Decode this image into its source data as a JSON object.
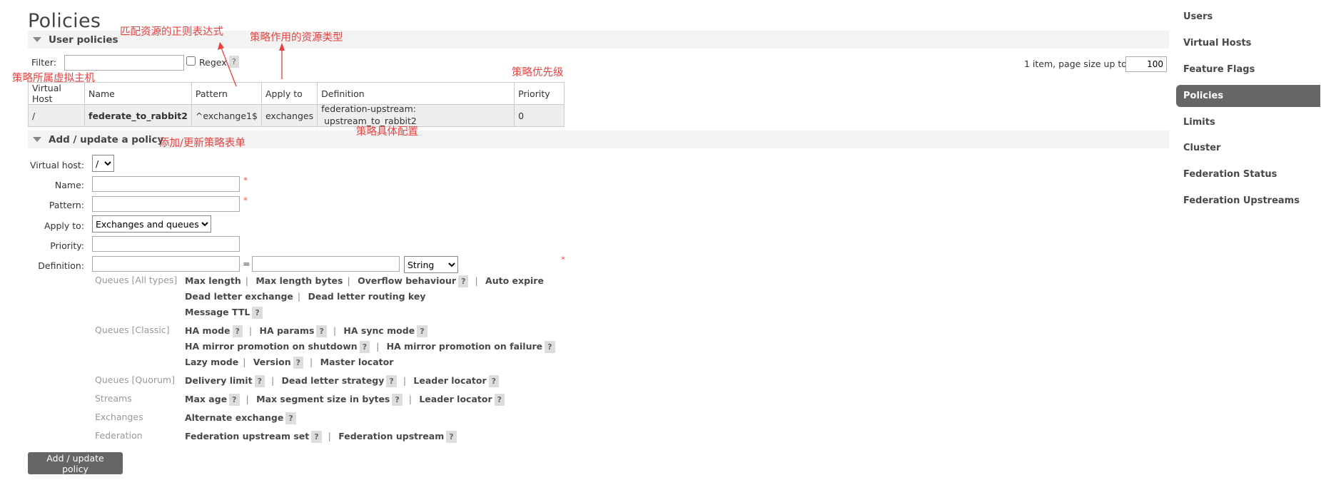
{
  "page": {
    "title": "Policies"
  },
  "user_policies": {
    "header": "User policies",
    "filter_label": "Filter:",
    "filter_value": "",
    "regex_label": "Regex",
    "help": "?",
    "pagination_text": "1 item, page size up to",
    "page_size": "100",
    "table": {
      "columns": [
        "Virtual Host",
        "Name",
        "Pattern",
        "Apply to",
        "Definition",
        "Priority"
      ],
      "rows": [
        {
          "vhost": "/",
          "name": "federate_to_rabbit2",
          "pattern": "^exchange1$",
          "apply_to": "exchanges",
          "definition_key": "federation-upstream:",
          "definition_value": "upstream_to_rabbit2",
          "priority": "0"
        }
      ]
    }
  },
  "add_policy": {
    "header": "Add / update a policy",
    "virtual_host_label": "Virtual host:",
    "virtual_host_value": "/",
    "name_label": "Name:",
    "pattern_label": "Pattern:",
    "apply_to_label": "Apply to:",
    "apply_to_value": "Exchanges and queues",
    "priority_label": "Priority:",
    "definition_label": "Definition:",
    "definition_equals": "=",
    "definition_type": "String",
    "required_marker": "*",
    "groups": {
      "queues_all": "Queues [All types]",
      "queues_classic": "Queues [Classic]",
      "queues_quorum": "Queues [Quorum]",
      "streams": "Streams",
      "exchanges": "Exchanges",
      "federation": "Federation"
    },
    "options": {
      "max_length": "Max length",
      "max_length_bytes": "Max length bytes",
      "overflow_behaviour": "Overflow behaviour",
      "auto_expire": "Auto expire",
      "dead_letter_exchange": "Dead letter exchange",
      "dead_letter_routing_key": "Dead letter routing key",
      "message_ttl": "Message TTL",
      "ha_mode": "HA mode",
      "ha_params": "HA params",
      "ha_sync_mode": "HA sync mode",
      "ha_mirror_shutdown": "HA mirror promotion on shutdown",
      "ha_mirror_failure": "HA mirror promotion on failure",
      "lazy_mode": "Lazy mode",
      "version": "Version",
      "master_locator": "Master locator",
      "delivery_limit": "Delivery limit",
      "dead_letter_strategy": "Dead letter strategy",
      "leader_locator": "Leader locator",
      "max_age": "Max age",
      "max_segment_size": "Max segment size in bytes",
      "alternate_exchange": "Alternate exchange",
      "federation_upstream_set": "Federation upstream set",
      "federation_upstream": "Federation upstream"
    },
    "submit_label": "Add / update policy"
  },
  "nav": {
    "items": [
      "Users",
      "Virtual Hosts",
      "Feature Flags",
      "Policies",
      "Limits",
      "Cluster",
      "Federation Status",
      "Federation Upstreams"
    ],
    "active": "Policies"
  },
  "annotations": {
    "regex_note": "匹配资源的正则表达式",
    "apply_type_note": "策略作用的资源类型",
    "priority_note": "策略优先级",
    "vhost_note": "策略所属虚拟主机",
    "definition_note": "策略具体配置",
    "form_note": "添加/更新策略表单"
  },
  "colors": {
    "annotation": "#e8403f",
    "nav_active_bg": "#666666",
    "button_bg": "#666666"
  }
}
